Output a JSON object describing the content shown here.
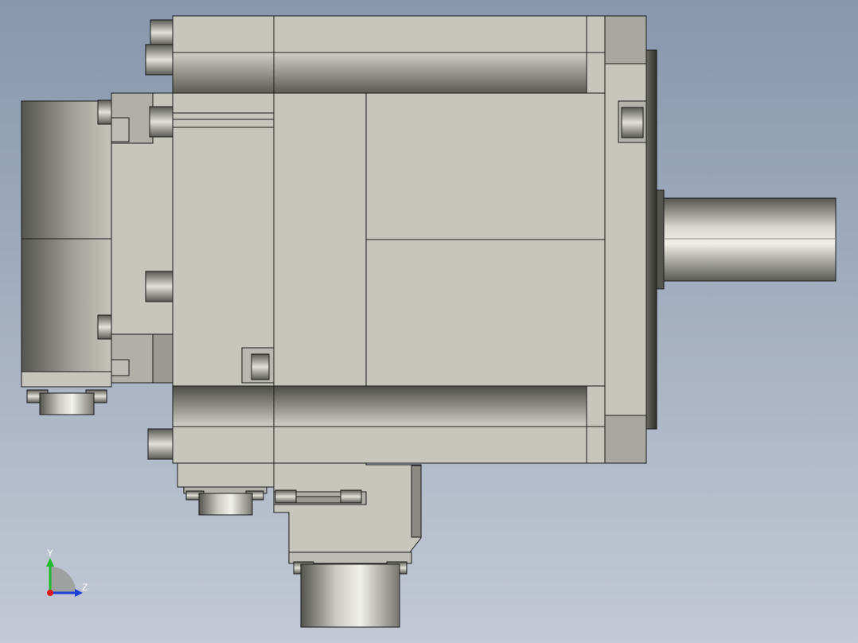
{
  "viewport": {
    "background_top": "#8797ad",
    "background_bottom": "#c3c9d5"
  },
  "model": {
    "body_color": "#c6c6bd",
    "edge_color": "#1a1a1a",
    "metal_light": "#f4f4ee",
    "metal_dark": "#4a4a44"
  },
  "triad": {
    "y_label": "Y",
    "z_label": "Z",
    "y_color": "#1dbb2a",
    "z_color": "#1d3fd4",
    "x_color": "#e01818"
  }
}
